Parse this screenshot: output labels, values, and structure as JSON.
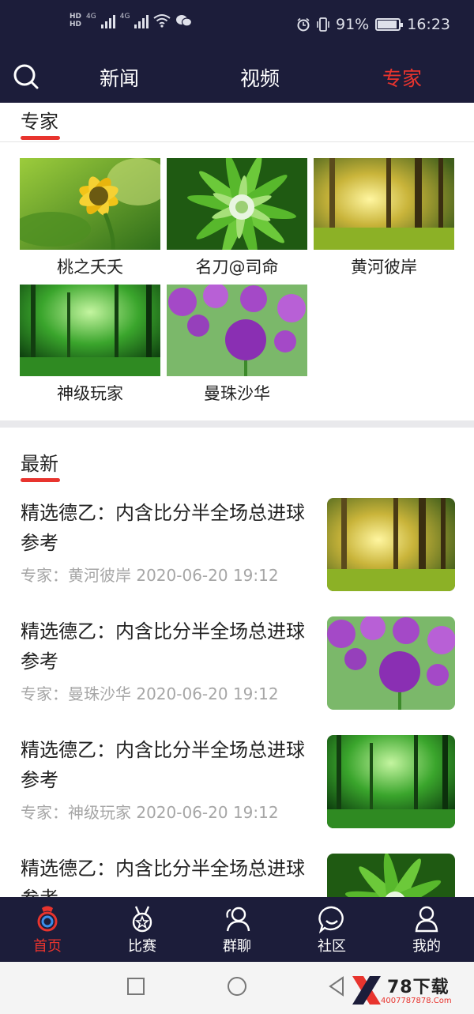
{
  "statusbar": {
    "hd1": "HD",
    "hd2": "HD",
    "net1": "4G",
    "net2": "4G",
    "battery_text": "91%",
    "battery_level": 0.91,
    "time": "16:23"
  },
  "topnav": {
    "tabs": [
      {
        "label": "新闻"
      },
      {
        "label": "视频"
      },
      {
        "label": "专家"
      }
    ],
    "active_tab": "专家"
  },
  "experts": {
    "heading": "专家",
    "items": [
      {
        "name": "桃之夭夭",
        "image": "sunflower"
      },
      {
        "name": "名刀@司命",
        "image": "green-flower"
      },
      {
        "name": "黄河彼岸",
        "image": "sunlit-forest"
      },
      {
        "name": "神级玩家",
        "image": "green-forest"
      },
      {
        "name": "曼珠沙华",
        "image": "purple-allium"
      }
    ]
  },
  "latest": {
    "heading": "最新",
    "items": [
      {
        "title": "精选德乙：内含比分半全场总进球参考",
        "meta": "专家：黄河彼岸  2020-06-20 19:12",
        "image": "sunlit-forest"
      },
      {
        "title": "精选德乙：内含比分半全场总进球参考",
        "meta": "专家：曼珠沙华  2020-06-20 19:12",
        "image": "purple-allium"
      },
      {
        "title": "精选德乙：内含比分半全场总进球参考",
        "meta": "专家：神级玩家  2020-06-20 19:12",
        "image": "green-forest"
      },
      {
        "title": "精选德乙：内含比分半全场总进球参考",
        "meta": "",
        "image": "green-flower"
      }
    ]
  },
  "bottomnav": {
    "items": [
      {
        "label": "首页",
        "icon": "home-icon"
      },
      {
        "label": "比赛",
        "icon": "medal-icon"
      },
      {
        "label": "群聊",
        "icon": "group-chat-icon"
      },
      {
        "label": "社区",
        "icon": "community-icon"
      },
      {
        "label": "我的",
        "icon": "profile-icon"
      }
    ],
    "active": "首页"
  },
  "watermark": {
    "brand": "78下载",
    "url": "4007787878.Com"
  },
  "colors": {
    "nav_bg": "#1c1d3a",
    "accent": "#e8342e"
  }
}
